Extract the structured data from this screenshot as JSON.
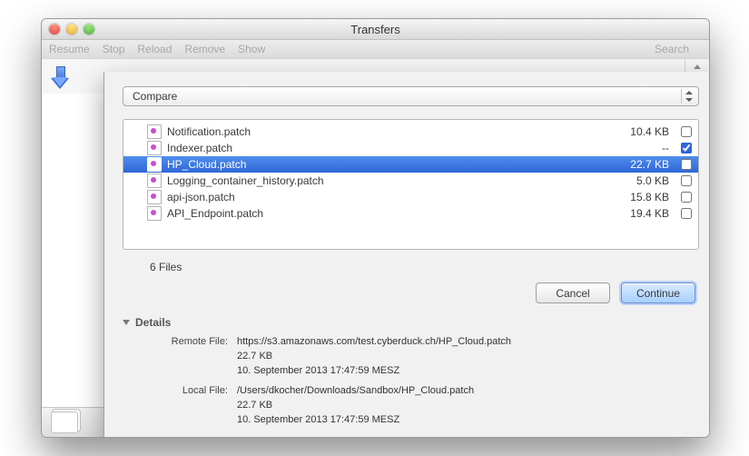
{
  "window": {
    "title": "Transfers"
  },
  "toolbar": {
    "resume": "Resume",
    "stop": "Stop",
    "reload": "Reload",
    "remove": "Remove",
    "show": "Show",
    "search": "Search"
  },
  "sheet": {
    "mode_label": "Compare",
    "files": [
      {
        "name": "Notification.patch",
        "size": "10.4 KB",
        "checked": false,
        "selected": false
      },
      {
        "name": "Indexer.patch",
        "size": "--",
        "checked": true,
        "selected": false
      },
      {
        "name": "HP_Cloud.patch",
        "size": "22.7 KB",
        "checked": false,
        "selected": true
      },
      {
        "name": "Logging_container_history.patch",
        "size": "5.0 KB",
        "checked": false,
        "selected": false
      },
      {
        "name": "api-json.patch",
        "size": "15.8 KB",
        "checked": false,
        "selected": false
      },
      {
        "name": "API_Endpoint.patch",
        "size": "19.4 KB",
        "checked": false,
        "selected": false
      }
    ],
    "count_label": "6 Files",
    "cancel_label": "Cancel",
    "continue_label": "Continue"
  },
  "details": {
    "header": "Details",
    "remote": {
      "label": "Remote File:",
      "path": "https://s3.amazonaws.com/test.cyberduck.ch/HP_Cloud.patch",
      "size": "22.7 KB",
      "date": "10. September 2013 17:47:59 MESZ"
    },
    "local": {
      "label": "Local File:",
      "path": "/Users/dkocher/Downloads/Sandbox/HP_Cloud.patch",
      "size": "22.7 KB",
      "date": "10. September 2013 17:47:59 MESZ"
    }
  }
}
